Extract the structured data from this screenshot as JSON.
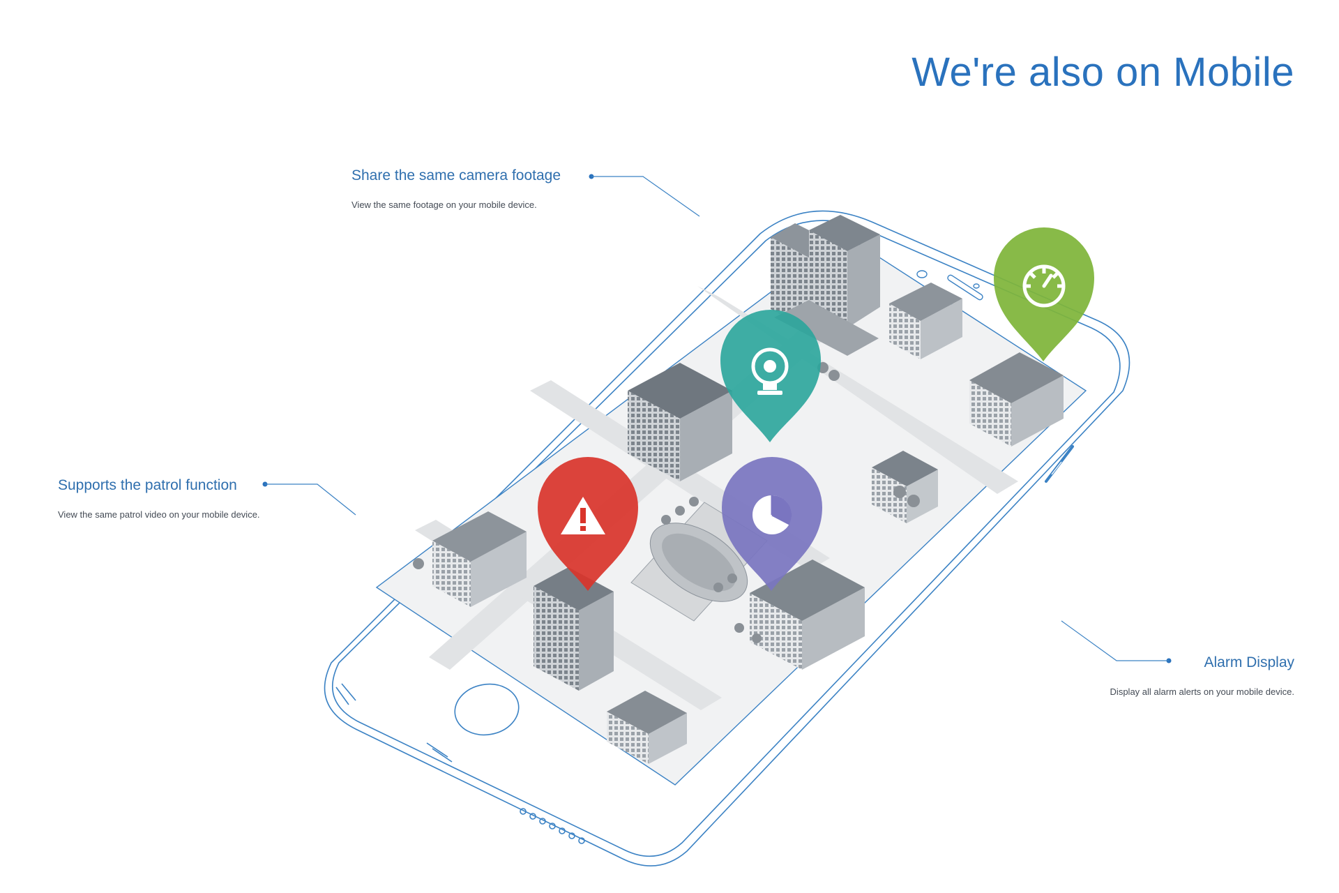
{
  "page": {
    "title": "We're also on Mobile"
  },
  "features": {
    "camera": {
      "title": "Share the same camera footage",
      "description": "View the same footage on your mobile device."
    },
    "patrol": {
      "title": "Supports the patrol function",
      "description": "View the same patrol video on your mobile device."
    },
    "alarm": {
      "title": "Alarm Display",
      "description": "Display all alarm alerts on your mobile device."
    }
  },
  "pins": [
    {
      "icon": "speedometer-icon",
      "color": "#7fb53a"
    },
    {
      "icon": "webcam-icon",
      "color": "#2aa59b"
    },
    {
      "icon": "alert-triangle-icon",
      "color": "#d9342b"
    },
    {
      "icon": "pie-chart-icon",
      "color": "#7a75c0"
    }
  ],
  "colors": {
    "accent": "#2a72bd",
    "outline": "#3b82c4"
  }
}
